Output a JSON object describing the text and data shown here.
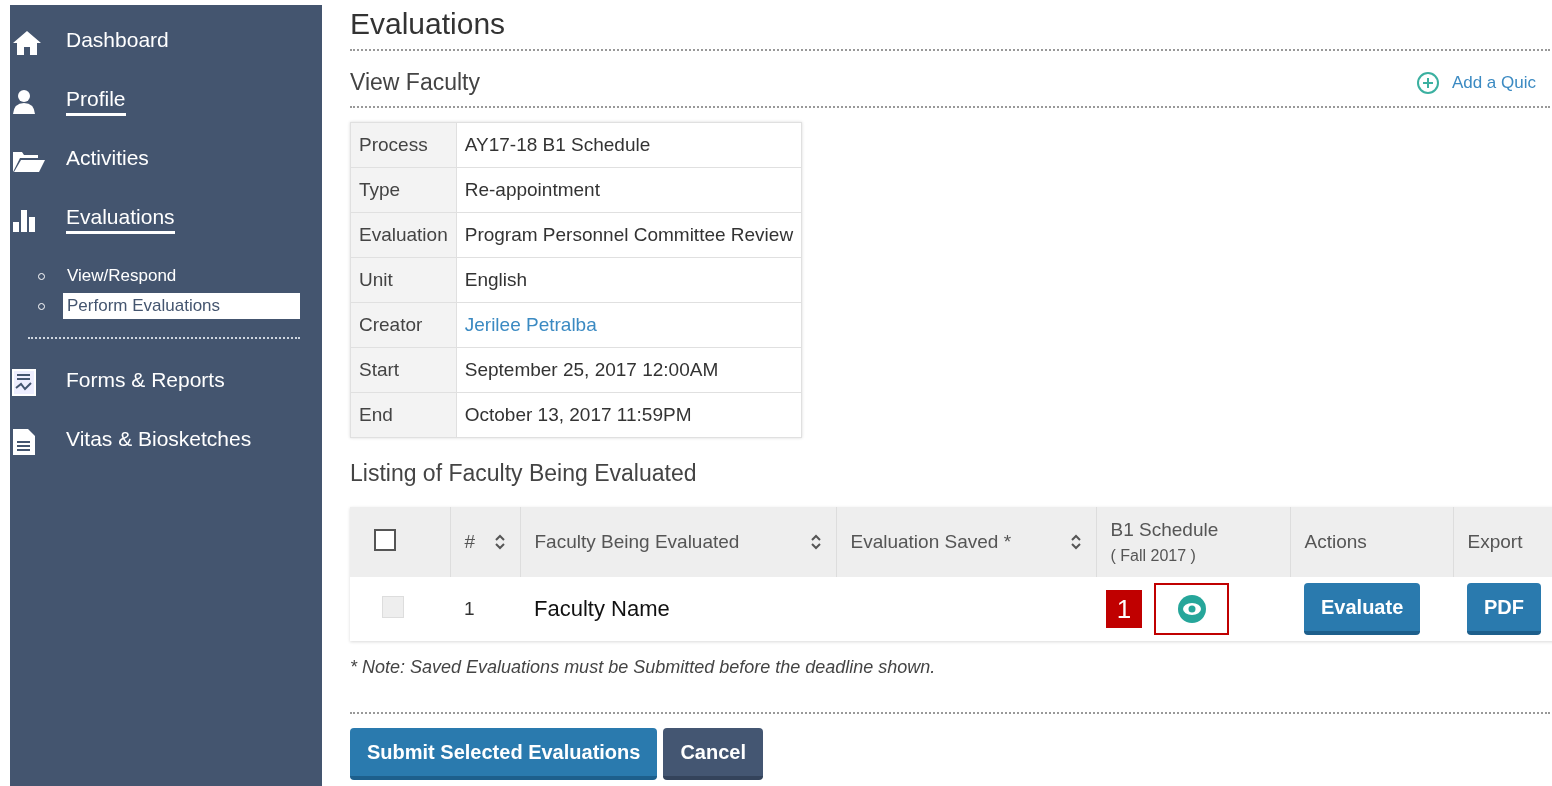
{
  "sidebar": {
    "items": [
      {
        "label": "Dashboard",
        "underlined": false
      },
      {
        "label": "Profile",
        "underlined": true
      },
      {
        "label": "Activities",
        "underlined": false
      },
      {
        "label": "Evaluations",
        "underlined": true,
        "children": [
          {
            "label": "View/Respond",
            "selected": false
          },
          {
            "label": "Perform Evaluations",
            "selected": true
          }
        ]
      },
      {
        "label": "Forms & Reports",
        "underlined": false
      },
      {
        "label": "Vitas & Biosketches",
        "underlined": false
      }
    ]
  },
  "page_title": "Evaluations",
  "section_title": "View Faculty",
  "quick_link": "Add a Quic",
  "details": [
    {
      "label": "Process",
      "value": "AY17-18 B1 Schedule",
      "kind": "text"
    },
    {
      "label": "Type",
      "value": "Re-appointment",
      "kind": "text"
    },
    {
      "label": "Evaluation",
      "value": "Program Personnel Committee Review",
      "kind": "text"
    },
    {
      "label": "Unit",
      "value": "English",
      "kind": "text"
    },
    {
      "label": "Creator",
      "value": "Jerilee Petralba",
      "kind": "link"
    },
    {
      "label": "Start",
      "value": "September 25, 2017 12:00AM",
      "kind": "text"
    },
    {
      "label": "End",
      "value": "October 13, 2017 11:59PM",
      "kind": "text"
    }
  ],
  "listing_title": "Listing of Faculty Being Evaluated",
  "table": {
    "select_all": {
      "checked": false
    },
    "columns": [
      {
        "label": "#",
        "sortable": true
      },
      {
        "label": "Faculty Being Evaluated",
        "sortable": true
      },
      {
        "label": "Evaluation Saved *",
        "sortable": true
      },
      {
        "label": "B1 Schedule",
        "sublabel": "( Fall 2017 )",
        "sortable": false
      },
      {
        "label": "Actions",
        "sortable": false
      },
      {
        "label": "Export",
        "sortable": false
      }
    ],
    "rows": [
      {
        "checked": false,
        "disabled": true,
        "number": "1",
        "faculty": "Faculty Name",
        "callout": "1",
        "action": "Evaluate",
        "export": "PDF"
      }
    ]
  },
  "note": "* Note: Saved Evaluations must be Submitted before the deadline shown.",
  "buttons": [
    {
      "label": "Submit Selected Evaluations",
      "kind": "primary"
    },
    {
      "label": "Cancel",
      "kind": "secondary"
    }
  ]
}
